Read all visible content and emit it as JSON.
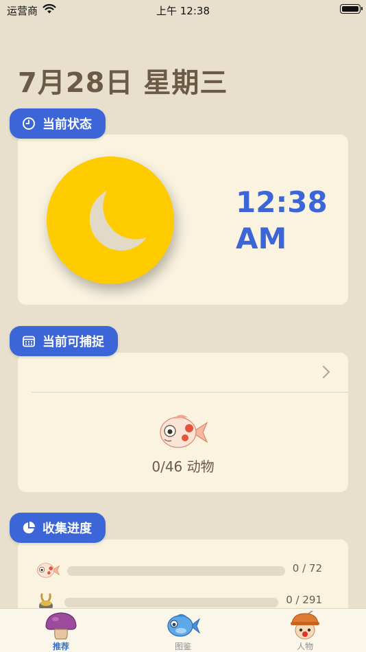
{
  "status_bar": {
    "carrier": "运营商",
    "time": "上午 12:38"
  },
  "page": {
    "date_title": "7月28日 星期三"
  },
  "sections": {
    "current_status": {
      "label": "当前状态",
      "icon": "clock-icon",
      "time_line1": "12:38",
      "time_line2": "AM"
    },
    "catchable": {
      "label": "当前可捕捉",
      "icon": "calendar-icon",
      "count_text": "0/46 动物"
    },
    "progress": {
      "label": "收集进度",
      "icon": "pie-chart-icon",
      "rows": [
        {
          "icon": "fish-icon",
          "text": "0 / 72",
          "fraction": 0
        },
        {
          "icon": "bug-icon",
          "text": "0 / 291",
          "fraction": 0
        }
      ]
    }
  },
  "tab_bar": {
    "tabs": [
      {
        "label": "推荐",
        "icon": "mushroom-icon",
        "active": true
      },
      {
        "label": "图鉴",
        "icon": "blue-fish-icon",
        "active": false
      },
      {
        "label": "人物",
        "icon": "villager-icon",
        "active": false
      }
    ]
  },
  "colors": {
    "accent": "#3c66d8",
    "background": "#e8e0cd",
    "card": "#faf3e0",
    "moon": "#ffcc00",
    "text": "#6b5a45"
  }
}
